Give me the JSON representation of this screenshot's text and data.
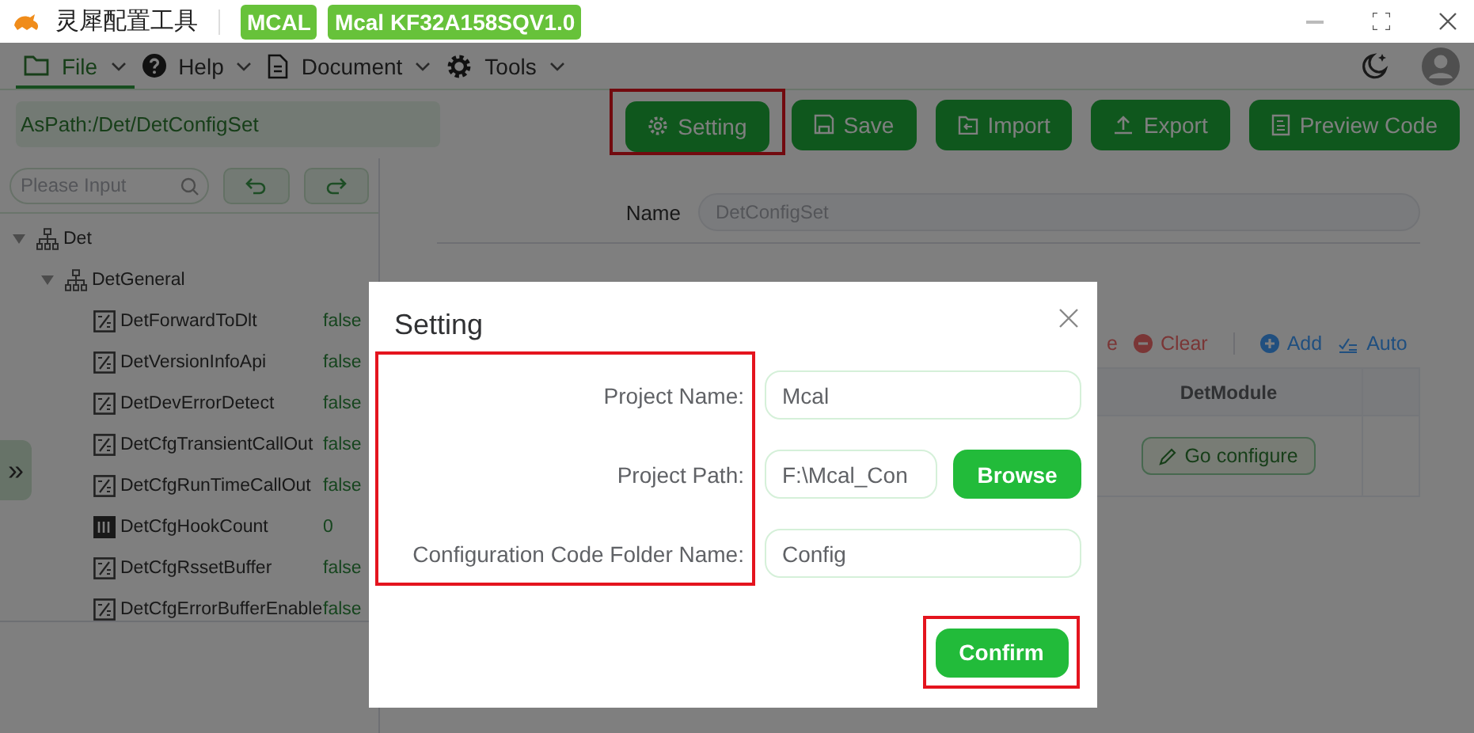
{
  "title_bar": {
    "app_name": "灵犀配置工具",
    "badges": [
      "MCAL",
      "Mcal KF32A158SQV1.0"
    ]
  },
  "menu": [
    {
      "label": "File",
      "selected": true
    },
    {
      "label": "Help",
      "selected": false
    },
    {
      "label": "Document",
      "selected": false
    },
    {
      "label": "Tools",
      "selected": false
    }
  ],
  "path_field": {
    "value": "AsPath:/Det/DetConfigSet"
  },
  "toolbar_buttons": [
    {
      "label": "Setting",
      "highlighted": true
    },
    {
      "label": "Save",
      "highlighted": false
    },
    {
      "label": "Import",
      "highlighted": false
    },
    {
      "label": "Export",
      "highlighted": false
    },
    {
      "label": "Preview Code",
      "highlighted": false
    }
  ],
  "tree_search": {
    "placeholder": "Please Input"
  },
  "expand_handle": "»",
  "tree": [
    {
      "label": "Det",
      "expanded": true,
      "children": [
        {
          "label": "DetGeneral",
          "expanded": true,
          "children": [
            {
              "label": "DetForwardToDlt",
              "kind": "boolean",
              "value": "false"
            },
            {
              "label": "DetVersionInfoApi",
              "kind": "boolean",
              "value": "false"
            },
            {
              "label": "DetDevErrorDetect",
              "kind": "boolean",
              "value": "false"
            },
            {
              "label": "DetCfgTransientCallOut",
              "kind": "boolean",
              "value": "false"
            },
            {
              "label": "DetCfgRunTimeCallOut",
              "kind": "boolean",
              "value": "false"
            },
            {
              "label": "DetCfgHookCount",
              "kind": "integer",
              "value": "0"
            },
            {
              "label": "DetCfgRssetBuffer",
              "kind": "boolean",
              "value": "false"
            },
            {
              "label": "DetCfgErrorBufferEnable",
              "kind": "boolean",
              "value": "false"
            }
          ]
        }
      ]
    }
  ],
  "name_field": {
    "label": "Name",
    "value": "DetConfigSet",
    "disabled": true
  },
  "table_toolbar": [
    {
      "label": "e",
      "kind": "delete"
    },
    {
      "label": "Clear",
      "kind": "clear"
    },
    {
      "label": "Add",
      "kind": "add"
    },
    {
      "label": "Auto",
      "kind": "auto"
    }
  ],
  "table": {
    "columns": [
      "DetModule"
    ],
    "rows": [
      {
        "action": "Go configure"
      }
    ]
  },
  "dialog": {
    "title": "Setting",
    "labels_highlighted": true,
    "fields": [
      {
        "label": "Project Name:",
        "value": "Mcal"
      },
      {
        "label": "Project Path:",
        "value": "F:\\Mcal_Con",
        "button": "Browse"
      },
      {
        "label": "Configuration Code Folder Name:",
        "value": "Config"
      }
    ],
    "confirm": {
      "label": "Confirm",
      "highlighted": true
    }
  }
}
